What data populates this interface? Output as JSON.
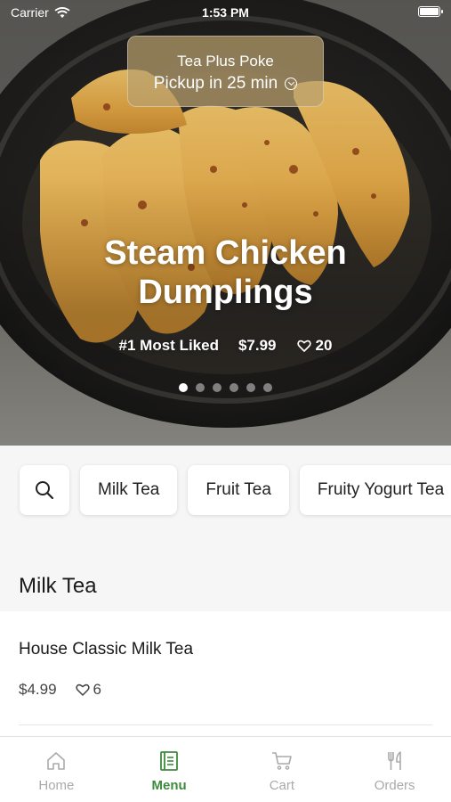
{
  "status_bar": {
    "carrier": "Carrier",
    "time": "1:53 PM"
  },
  "pickup": {
    "store_name": "Tea Plus Poke",
    "eta": "Pickup in 25 min"
  },
  "featured": {
    "title": "Steam Chicken Dumplings",
    "rank": "#1 Most Liked",
    "price": "$7.99",
    "likes": "20",
    "slide_count": 6,
    "active_slide": 0
  },
  "categories": {
    "search_icon": "search-icon",
    "items": [
      "Milk Tea",
      "Fruit Tea",
      "Fruity Yogurt Tea"
    ]
  },
  "section": {
    "title": "Milk Tea"
  },
  "menu_items": [
    {
      "name": "House Classic Milk Tea",
      "price": "$4.99",
      "likes": "6"
    }
  ],
  "tabbar": {
    "active": "Menu",
    "accent_color": "#3d8b3d",
    "tabs": [
      {
        "label": "Home",
        "icon": "home-icon"
      },
      {
        "label": "Menu",
        "icon": "menu-book-icon"
      },
      {
        "label": "Cart",
        "icon": "cart-icon"
      },
      {
        "label": "Orders",
        "icon": "fork-knife-icon"
      }
    ]
  }
}
